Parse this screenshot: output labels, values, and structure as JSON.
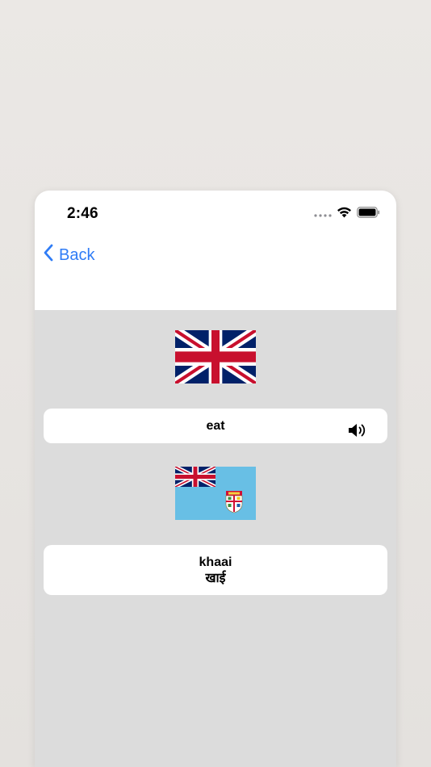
{
  "status_bar": {
    "time": "2:46",
    "icons": [
      "signal-dots-icon",
      "wifi-icon",
      "battery-icon"
    ]
  },
  "nav": {
    "back_label": "Back",
    "back_icon": "chevron-left-icon",
    "accent_color": "#2f7cf6"
  },
  "source": {
    "flag": "united-kingdom-flag",
    "word": "eat",
    "speaker_icon": "speaker-icon"
  },
  "target": {
    "flag": "fiji-flag",
    "word": "khaai",
    "script": "खाई"
  }
}
